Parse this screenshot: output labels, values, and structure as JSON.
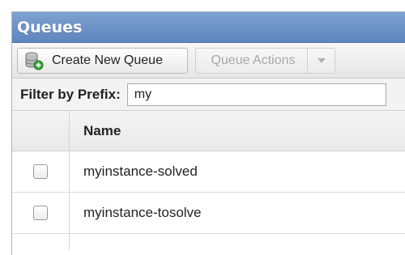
{
  "panel": {
    "title": "Queues"
  },
  "toolbar": {
    "create_label": "Create New Queue",
    "create_icon": "database-add-icon",
    "actions_label": "Queue Actions",
    "actions_dropdown_icon": "chevron-down-icon"
  },
  "filter": {
    "label": "Filter by Prefix:",
    "value": "my"
  },
  "table": {
    "columns": [
      "",
      "Name"
    ],
    "rows": [
      {
        "name": "myinstance-solved",
        "checked": false
      },
      {
        "name": "myinstance-tosolve",
        "checked": false
      }
    ]
  }
}
